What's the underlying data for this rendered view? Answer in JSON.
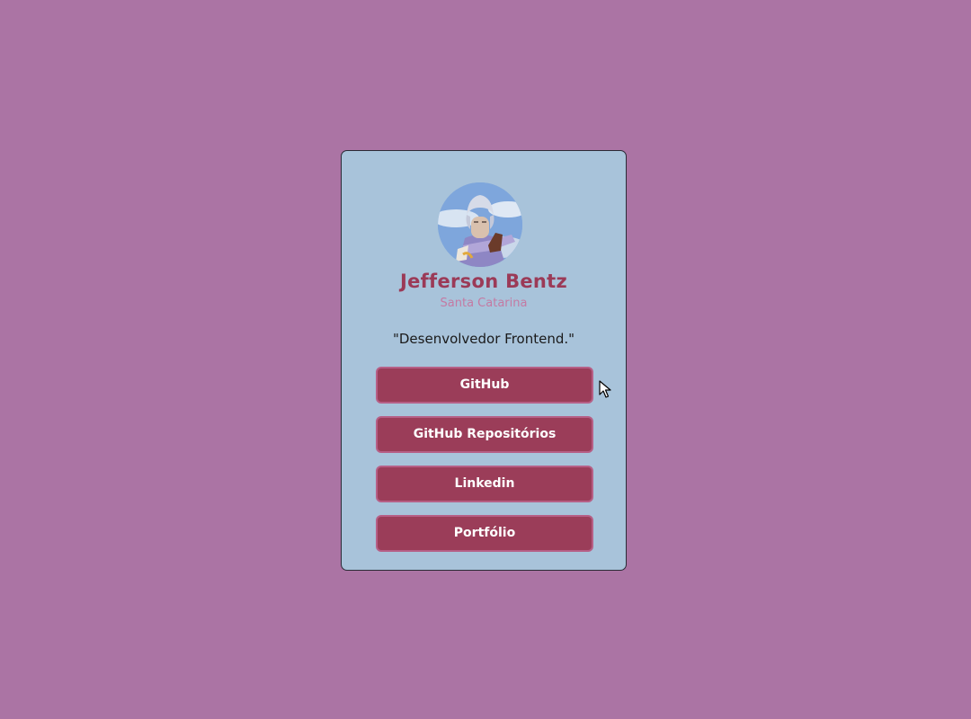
{
  "profile": {
    "name": "Jefferson Bentz",
    "location": "Santa Catarina",
    "bio": "\"Desenvolvedor Frontend.\""
  },
  "links": [
    {
      "label": "GitHub"
    },
    {
      "label": "GitHub Repositórios"
    },
    {
      "label": "Linkedin"
    },
    {
      "label": "Portfólio"
    }
  ],
  "colors": {
    "background": "#ab74a4",
    "card": "#a8c3da",
    "accent": "#9b3a57",
    "button": "#9b3d59",
    "location": "#c47aa3"
  }
}
